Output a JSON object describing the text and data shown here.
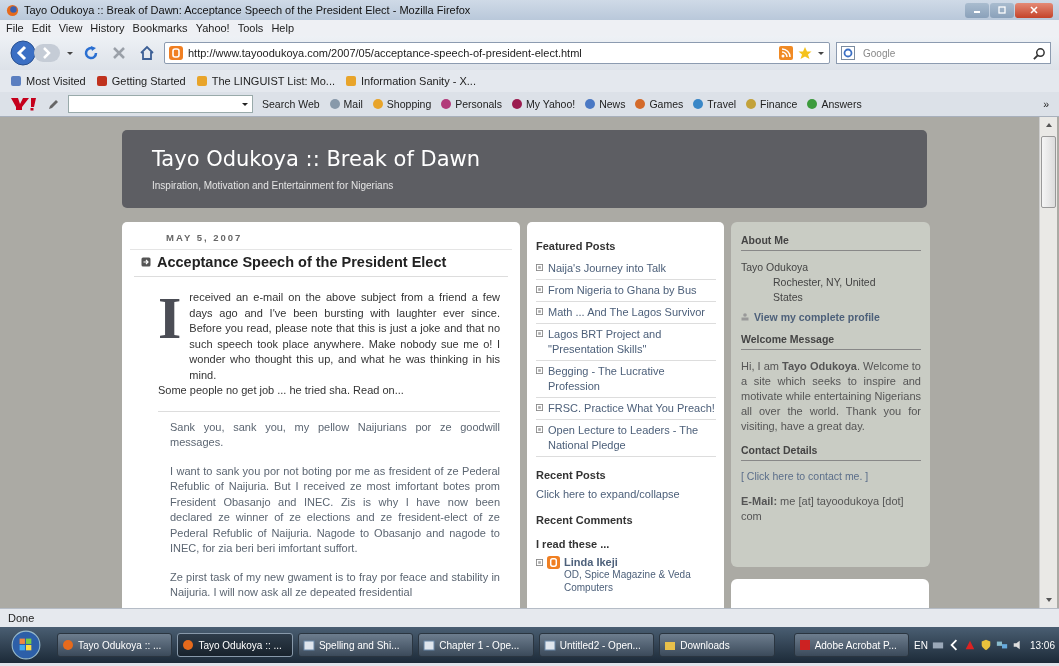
{
  "window": {
    "title": "Tayo Odukoya :: Break of Dawn: Acceptance Speech of the President Elect - Mozilla Firefox"
  },
  "menu": [
    "File",
    "Edit",
    "View",
    "History",
    "Bookmarks",
    "Yahoo!",
    "Tools",
    "Help"
  ],
  "nav": {
    "url": "http://www.tayoodukoya.com/2007/05/acceptance-speech-of-president-elect.html",
    "search_placeholder": "Google"
  },
  "bookmarks": [
    "Most Visited",
    "Getting Started",
    "The LINGUIST List: Mo...",
    "Information Sanity - X..."
  ],
  "yahoo_toolbar": {
    "search_button": "Search Web",
    "items": [
      "Mail",
      "Shopping",
      "Personals",
      "My Yahoo!",
      "News",
      "Games",
      "Travel",
      "Finance",
      "Answers"
    ],
    "more": "»"
  },
  "blog": {
    "title": "Tayo Odukoya :: Break of Dawn",
    "tagline": "Inspiration, Motivation and Entertainment for Nigerians"
  },
  "post": {
    "date": "MAY 5, 2007",
    "title": "Acceptance Speech of the President Elect",
    "drop_cap": "I",
    "intro": "received an e-mail on the above subject from a friend a few days ago and I've been bursting with laughter ever since. Before you read, please note that this is just a joke and that no such speech took place anywhere. Make nobody sue me o! I wonder who thought this up, and what he was thinking in his mind.",
    "intro_last": "Some people no get job ... he tried sha. Read on...",
    "quote": [
      "Sank you, sank you, my pellow Naijurians por ze goodwill messages.",
      "I want to sank you por not boting por me as fresident of ze Pederal Refublic of Naijuria. But I received ze most imfortant botes prom Fresident Obasanjo and INEC. Zis is why I have now been declared ze winner of ze elections and ze fresident-elect of ze Pederal Refublic of Naijuria. Nagode to Obasanjo and nagode to INEC, for zia beri beri imfortant suffort.",
      "Ze pirst task of my new gwament is to fray por feace and stability in Naijuria. I will now ask all ze depeated fresidential"
    ]
  },
  "featured": {
    "heading": "Featured Posts",
    "items": [
      "Naija's Journey into Talk",
      "From Nigeria to Ghana by Bus",
      "Math ... And The Lagos Survivor",
      "Lagos BRT Project and \"Presentation Skills\"",
      "Begging - The Lucrative Profession",
      "FRSC. Practice What You Preach!",
      "Open Lecture to Leaders - The National Pledge"
    ]
  },
  "recent_posts": {
    "heading": "Recent Posts",
    "link": "Click here to expand/collapse"
  },
  "recent_comments": {
    "heading": "Recent Comments"
  },
  "blogroll": {
    "heading": "I read these ...",
    "items": [
      {
        "name": "Linda Ikeji",
        "description": "OD, Spice Magazine & Veda Computers"
      }
    ]
  },
  "about": {
    "heading": "About Me",
    "name": "Tayo Odukoya",
    "location": "Rochester, NY, United States",
    "profile_link": "View my complete profile"
  },
  "welcome": {
    "heading": "Welcome Message",
    "text": "Hi, I am **Tayo Odukoya**. Welcome to a site which seeks to inspire and motivate while entertaining Nigerians all over the world. Thank you for visiting, have a great day."
  },
  "contact": {
    "heading": "Contact Details",
    "link": "[ Click here to contact me. ]",
    "email": "**E-Mail:** me [at] tayoodukoya [dot] com"
  },
  "status_bar": "Done",
  "taskbar": {
    "items": [
      {
        "label": "Tayo Odukoya :: ...",
        "selected": false,
        "kind": "firefox"
      },
      {
        "label": "Tayo Odukoya :: ...",
        "selected": true,
        "kind": "firefox"
      },
      {
        "label": "Spelling and Shi...",
        "selected": false,
        "kind": "office"
      },
      {
        "label": "Chapter 1 - Ope...",
        "selected": false,
        "kind": "office"
      },
      {
        "label": "Untitled2 - Open...",
        "selected": false,
        "kind": "office"
      },
      {
        "label": "Downloads",
        "selected": false,
        "kind": "folder"
      },
      {
        "label": "Adobe Acrobat P...",
        "selected": false,
        "kind": "acrobat"
      }
    ],
    "language": "EN",
    "clock": "13:06"
  }
}
